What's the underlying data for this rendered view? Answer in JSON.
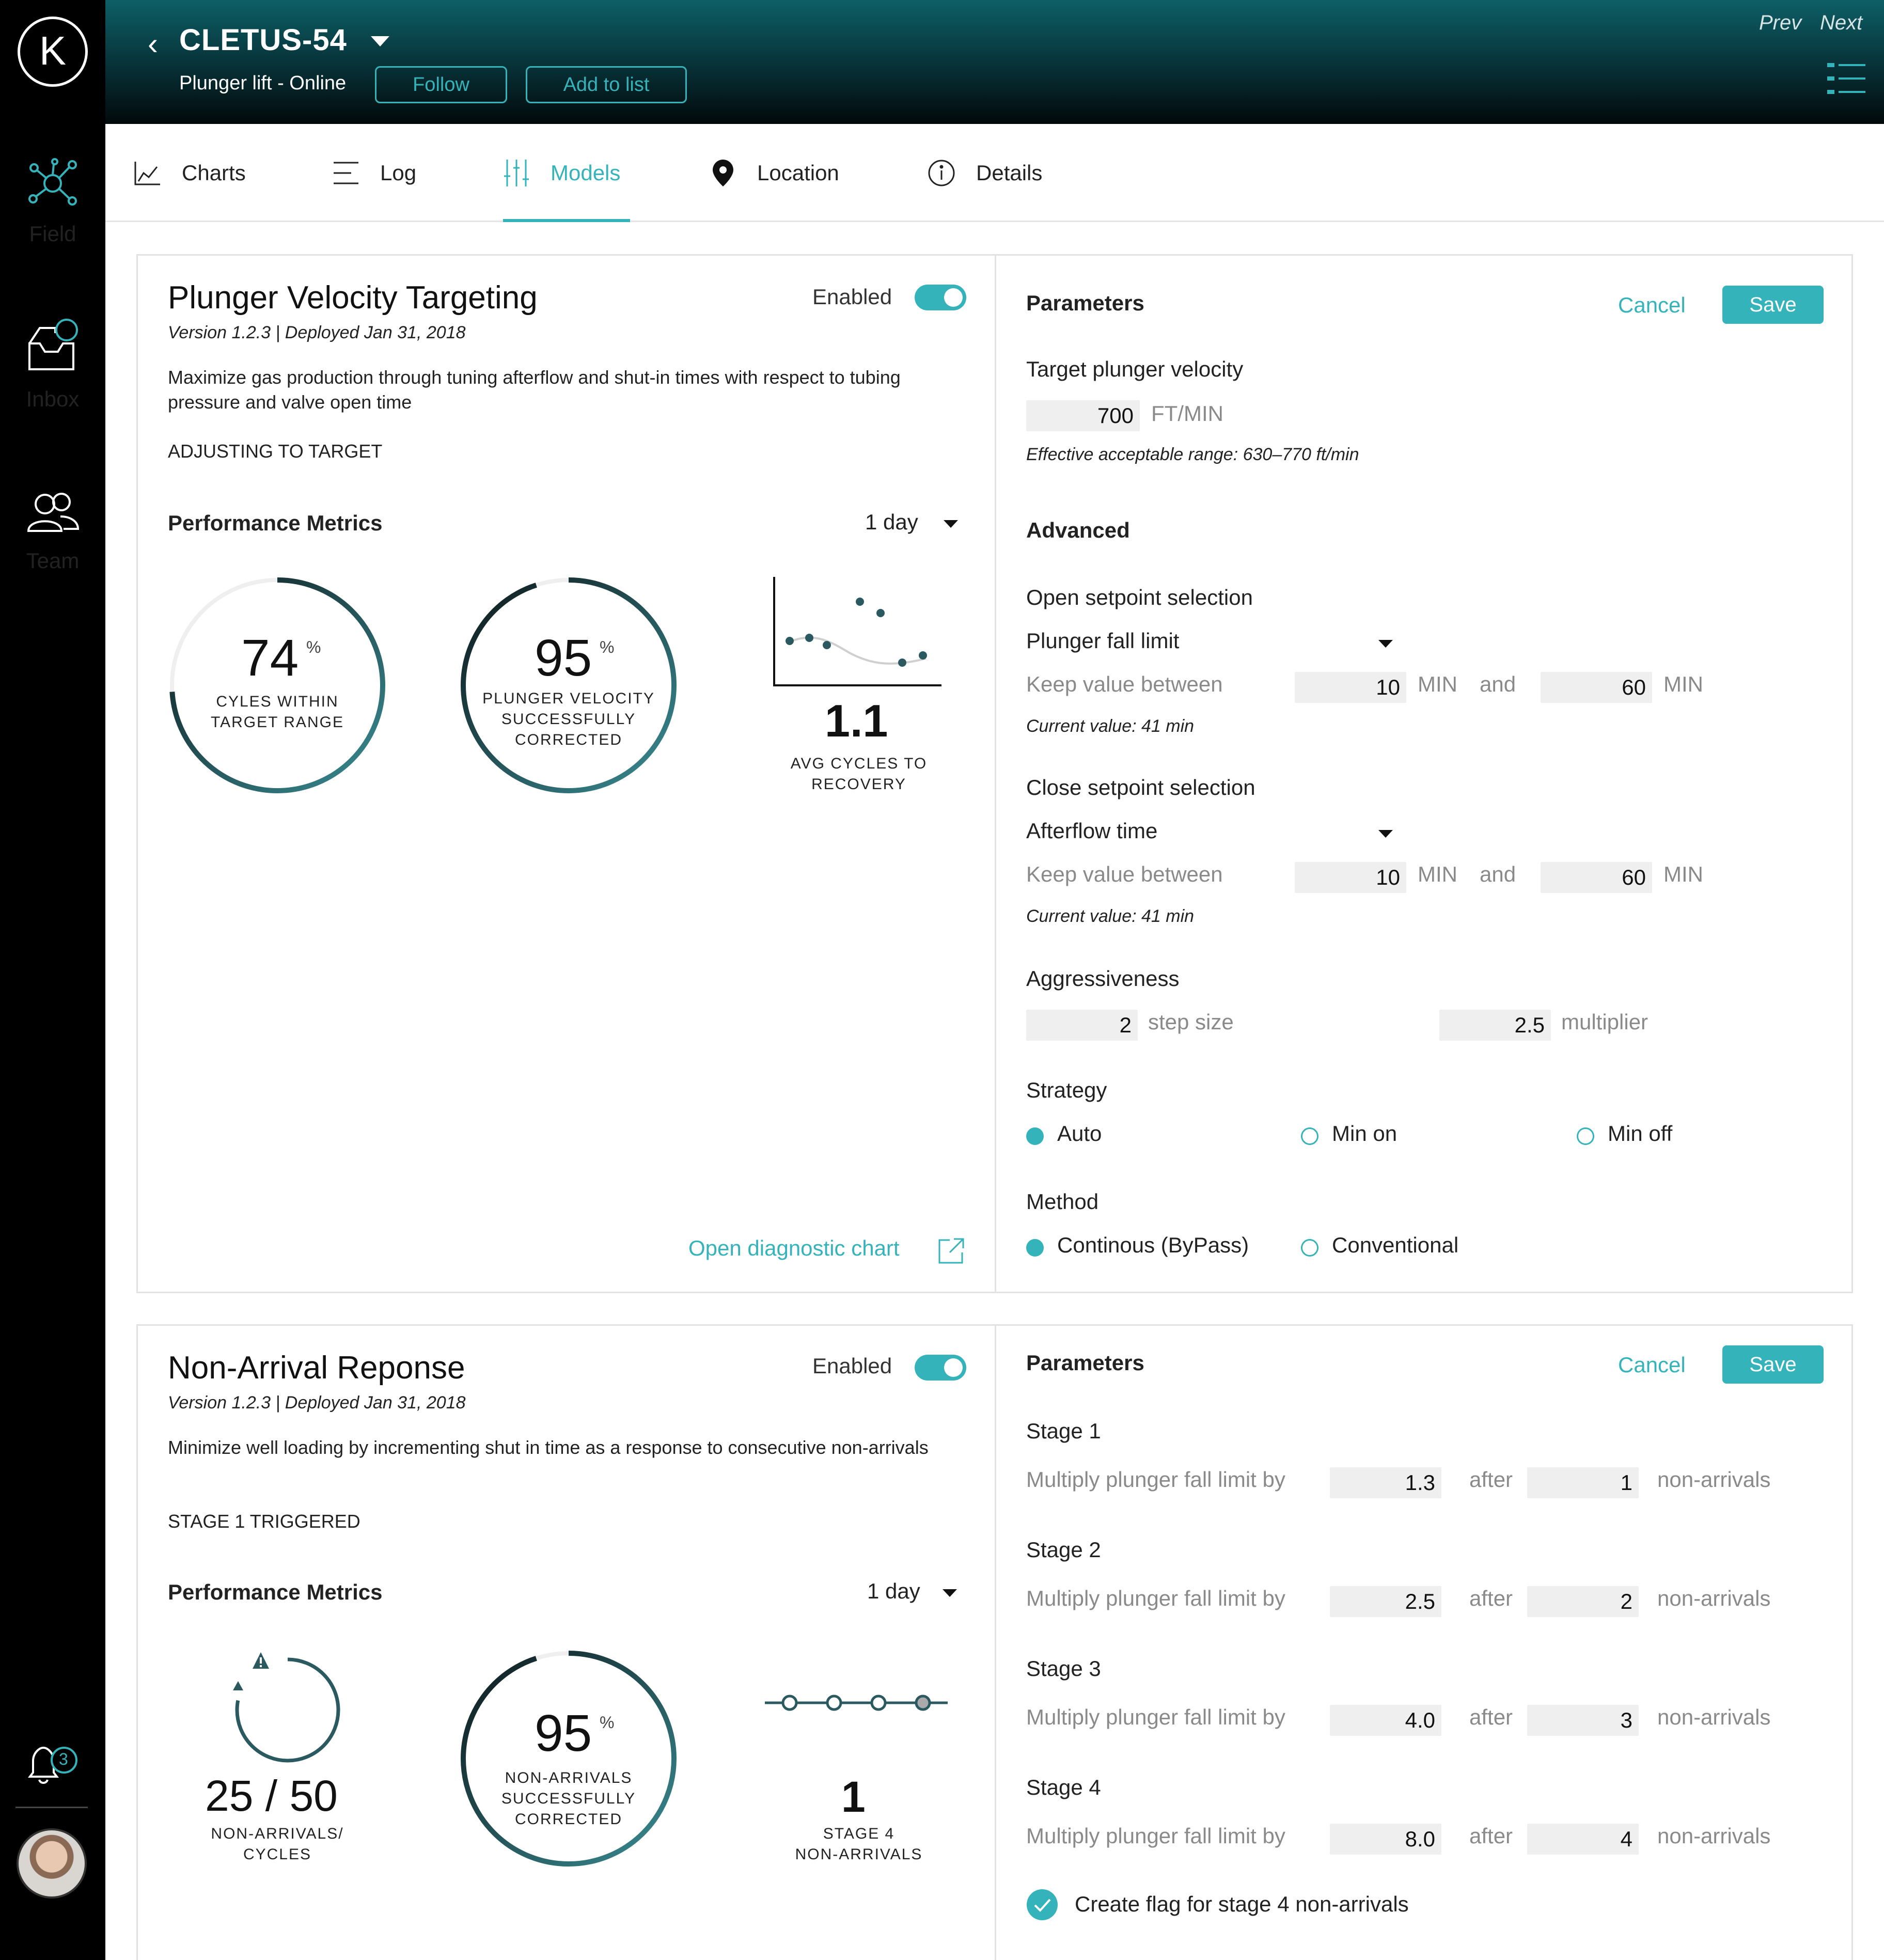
{
  "app": {
    "logo_letter": "K",
    "nav": [
      {
        "label": "Field",
        "active": true
      },
      {
        "label": "Inbox",
        "active": false
      },
      {
        "label": "Team",
        "active": false
      }
    ],
    "notification_count": "3",
    "accent_color": "#35b3bb"
  },
  "header": {
    "well_name": "CLETUS-54",
    "well_subtitle": "Plunger lift - Online",
    "follow_label": "Follow",
    "add_to_list_label": "Add to list",
    "prev_label": "Prev",
    "next_label": "Next"
  },
  "tabs": [
    {
      "label": "Charts",
      "icon": "line-chart-icon"
    },
    {
      "label": "Log",
      "icon": "list-icon"
    },
    {
      "label": "Models",
      "icon": "sliders-icon",
      "active": true
    },
    {
      "label": "Location",
      "icon": "pin-icon"
    },
    {
      "label": "Details",
      "icon": "info-icon"
    }
  ],
  "model1": {
    "title": "Plunger Velocity Targeting",
    "enabled_label": "Enabled",
    "enabled": true,
    "version": "Version 1.2.3 | Deployed Jan 31, 2018",
    "description": "Maximize gas production through tuning afterflow and shut-in times with respect to tubing pressure and valve open time",
    "status": "ADJUSTING TO TARGET",
    "metrics_title": "Performance Metrics",
    "period": "1 day",
    "gauge1": {
      "value": "74",
      "unit": "%",
      "caption_line1": "CYLES WITHIN",
      "caption_line2": "TARGET RANGE",
      "fraction": 0.74
    },
    "gauge2": {
      "value": "95",
      "unit": "%",
      "caption_line1": "PLUNGER VELOCITY",
      "caption_line2": "SUCCESSFULLY",
      "caption_line3": "CORRECTED",
      "fraction": 0.95
    },
    "stat3": {
      "value": "1.1",
      "caption_line1": "AVG CYCLES TO",
      "caption_line2": "RECOVERY"
    },
    "diag_link": "Open diagnostic chart",
    "params": {
      "title": "Parameters",
      "cancel": "Cancel",
      "save": "Save",
      "target_label": "Target plunger velocity",
      "target_value": "700",
      "target_unit": "FT/MIN",
      "range_note": "Effective acceptable range: 630–770 ft/min",
      "advanced": "Advanced",
      "open_sel_label": "Open setpoint selection",
      "open_sel_value": "Plunger fall limit",
      "keep_label": "Keep value between",
      "open_min": "10",
      "open_max": "60",
      "min_unit": "MIN",
      "and": "and",
      "open_current": "Current value: 41 min",
      "close_sel_label": "Close setpoint selection",
      "close_sel_value": "Afterflow time",
      "close_min": "10",
      "close_max": "60",
      "close_current": "Current value: 41 min",
      "aggr_label": "Aggressiveness",
      "step_value": "2",
      "step_label": "step size",
      "mult_value": "2.5",
      "mult_label": "multiplier",
      "strategy_label": "Strategy",
      "strategy_options": [
        "Auto",
        "Min on",
        "Min off"
      ],
      "strategy_selected": 0,
      "method_label": "Method",
      "method_options": [
        "Continous (ByPass)",
        "Conventional"
      ],
      "method_selected": 0
    }
  },
  "model2": {
    "title": "Non-Arrival Reponse",
    "enabled_label": "Enabled",
    "enabled": true,
    "version": "Version 1.2.3 | Deployed Jan 31, 2018",
    "description": "Minimize well loading by incrementing shut in time as a response to consecutive non-arrivals",
    "status": "STAGE 1 TRIGGERED",
    "metrics_title": "Performance Metrics",
    "period": "1 day",
    "stat1": {
      "value": "25 / 50",
      "caption_line1": "NON-ARRIVALS/",
      "caption_line2": "CYCLES",
      "fraction": 0.5
    },
    "gauge2": {
      "value": "95",
      "unit": "%",
      "caption_line1": "NON-ARRIVALS",
      "caption_line2": "SUCCESSFULLY",
      "caption_line3": "CORRECTED",
      "fraction": 0.95
    },
    "stat3": {
      "value": "1",
      "caption_line1": "STAGE 4",
      "caption_line2": "NON-ARRIVALS"
    },
    "params": {
      "title": "Parameters",
      "cancel": "Cancel",
      "save": "Save",
      "multiply_label": "Multiply plunger fall limit by",
      "after_label": "after",
      "nonarr_label": "non-arrivals",
      "stages": [
        {
          "label": "Stage 1",
          "factor": "1.3",
          "count": "1"
        },
        {
          "label": "Stage 2",
          "factor": "2.5",
          "count": "2"
        },
        {
          "label": "Stage 3",
          "factor": "4.0",
          "count": "3"
        },
        {
          "label": "Stage 4",
          "factor": "8.0",
          "count": "4"
        }
      ],
      "flag_label": "Create flag for stage 4 non-arrivals",
      "flag_checked": true
    }
  }
}
